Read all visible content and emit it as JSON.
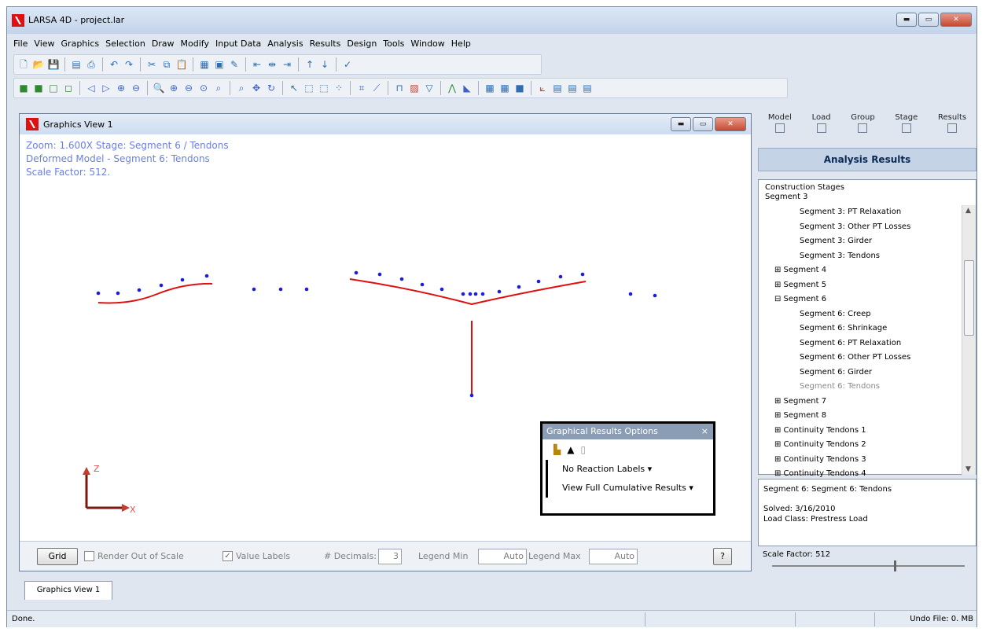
{
  "app": {
    "title": "LARSA 4D - project.lar",
    "min": "▬",
    "max": "▭",
    "close": "✕"
  },
  "menu": [
    "File",
    "View",
    "Graphics",
    "Selection",
    "Draw",
    "Modify",
    "Input Data",
    "Analysis",
    "Results",
    "Design",
    "Tools",
    "Window",
    "Help"
  ],
  "graphics_view": {
    "title": "Graphics View 1",
    "zoom_line": "Zoom: 1.600X    Stage: Segment 6 / Tendons",
    "model_line": "Deformed Model - Segment 6: Tendons",
    "scale_line": "Scale Factor: 512.",
    "axis_z": "Z",
    "axis_x": "X"
  },
  "results_options": {
    "title": "Graphical Results Options",
    "close": "×",
    "reaction_labels": "No Reaction Labels",
    "cumulative": "View Full Cumulative Results"
  },
  "bottom_controls": {
    "grid": "Grid",
    "render_out_of_scale": "Render Out of Scale",
    "value_labels": "Value Labels",
    "decimals_label": "# Decimals:",
    "decimals_value": "3",
    "legend_min_label": "Legend Min",
    "legend_min_value": "Auto",
    "legend_max_label": "Legend Max",
    "legend_max_value": "Auto",
    "help": "?"
  },
  "right_panel": {
    "tabs": [
      "Model",
      "Load",
      "Group",
      "Stage",
      "Results"
    ],
    "header": "Analysis Results",
    "tree_top_1": "Construction Stages",
    "tree_top_2": "Segment 3",
    "items": [
      {
        "label": "Segment 3: PT Relaxation",
        "level": 2
      },
      {
        "label": "Segment 3: Other PT Losses",
        "level": 2
      },
      {
        "label": "Segment 3: Girder",
        "level": 2
      },
      {
        "label": "Segment 3: Tendons",
        "level": 2
      },
      {
        "label": "⊞ Segment 4",
        "level": 1
      },
      {
        "label": "⊞ Segment 5",
        "level": 1
      },
      {
        "label": "⊟ Segment 6",
        "level": 1
      },
      {
        "label": "Segment 6: Creep",
        "level": 2
      },
      {
        "label": "Segment 6: Shrinkage",
        "level": 2
      },
      {
        "label": "Segment 6: PT Relaxation",
        "level": 2
      },
      {
        "label": "Segment 6: Other PT Losses",
        "level": 2
      },
      {
        "label": "Segment 6: Girder",
        "level": 2
      },
      {
        "label": "Segment 6: Tendons",
        "level": 2,
        "dim": true
      },
      {
        "label": "⊞ Segment 7",
        "level": 1
      },
      {
        "label": "⊞ Segment 8",
        "level": 1
      },
      {
        "label": "⊞ Continuity Tendons 1",
        "level": 1
      },
      {
        "label": "⊞ Continuity Tendons 2",
        "level": 1
      },
      {
        "label": "⊞ Continuity Tendons 3",
        "level": 1
      },
      {
        "label": "⊞ Continuity Tendons 4",
        "level": 1
      }
    ],
    "detail_title": "Segment 6: Segment 6: Tendons",
    "detail_solved": "Solved: 3/16/2010",
    "detail_loadclass": "Load Class: Prestress Load",
    "scale_factor": "Scale Factor: 512"
  },
  "bottom_tab": "Graphics View 1",
  "status": {
    "left": "Done.",
    "undo": "Undo File: 0. MB"
  },
  "colors": {
    "deformed": "#e01010",
    "nodes": "#1c1ce0",
    "info_text": "#6b7fe0"
  }
}
